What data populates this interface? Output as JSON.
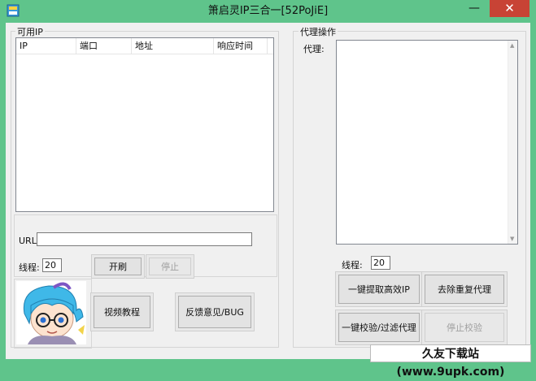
{
  "window": {
    "title": "箫启灵IP三合一[52PoJiE]",
    "minimize_glyph": "—",
    "close_glyph": "✕",
    "accent_color": "#5fc48b",
    "close_color": "#c84335"
  },
  "left_panel": {
    "group_title": "可用IP",
    "list_columns": [
      "IP",
      "端口",
      "地址",
      "响应时间"
    ],
    "url_label": "URL:",
    "url_value": "",
    "threads_label": "线程:",
    "threads_value": "20",
    "refresh_button": "开刷",
    "stop_button": "停止",
    "video_button": "视频教程",
    "feedback_button": "反馈意见/BUG"
  },
  "right_panel": {
    "group_title": "代理操作",
    "proxy_label": "代理:",
    "proxy_text": "",
    "threads_label": "线程:",
    "threads_value": "20",
    "extract_button": "一键提取高效IP",
    "dedupe_button": "去除重复代理",
    "verify_button": "一键校验/过滤代理",
    "stop_verify_button": "停止校验"
  },
  "watermark": "久友下载站(www.9upk.com)",
  "icons": {
    "app": "app-icon",
    "avatar": "anime-avatar"
  }
}
